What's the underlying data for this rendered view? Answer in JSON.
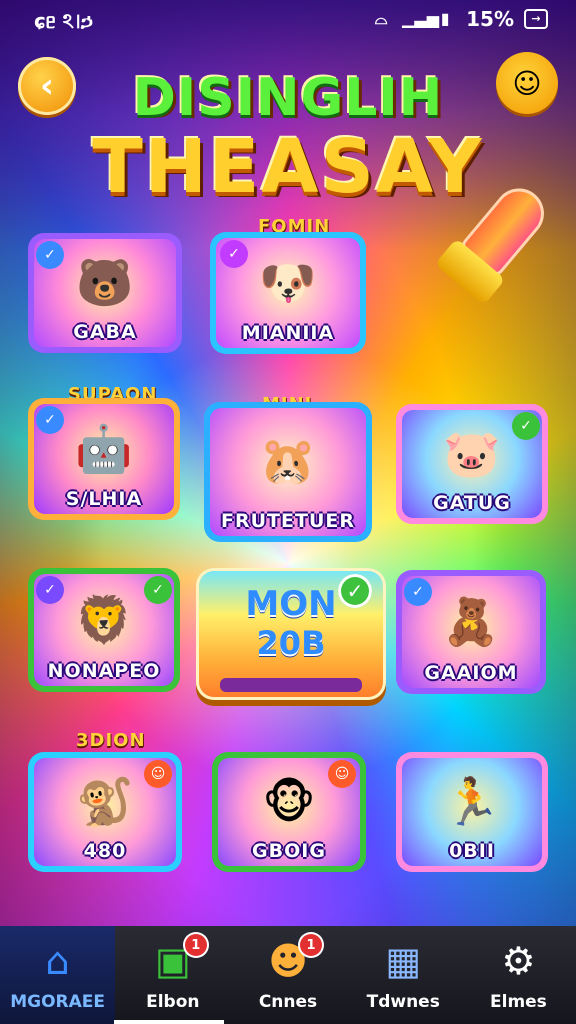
{
  "status": {
    "time": "ɕᥱ ঽ।ኃ",
    "battery": "15%"
  },
  "header": {
    "title_line1": "DISINGLIH",
    "title_line2": "THEASAY"
  },
  "colors": {
    "accent": "#ffcf2e",
    "nav_bg": "#1c1c24",
    "active": "#2e6bff"
  },
  "tiles": [
    {
      "label": "GABA",
      "above": "",
      "icon": "bear-icon"
    },
    {
      "label": "MIANIIA",
      "above": "FOMIN",
      "icon": "puppy-icon"
    },
    {
      "label": "S/LHIA",
      "above": "SUPAON",
      "icon": "robot-icon"
    },
    {
      "label": "FRUTETUER",
      "above": "MINI",
      "icon": "hamster-icon"
    },
    {
      "label": "GATUG",
      "above": "",
      "icon": "pig-icon"
    },
    {
      "label": "NONAPEO",
      "above": "",
      "icon": "lion-icon"
    },
    {
      "label": "GAAIOM",
      "above": "",
      "icon": "teddy-icon"
    },
    {
      "label": "480",
      "above": "3DION",
      "icon": "monkey-icon"
    },
    {
      "label": "GBOIG",
      "above": "",
      "icon": "monkey-pair-icon"
    },
    {
      "label": "0BII",
      "above": "",
      "icon": "runner-icon"
    }
  ],
  "center": {
    "line1": "MON",
    "line2": "20B"
  },
  "nav": [
    {
      "label": "MGORAEE",
      "icon": "home-icon",
      "active": true
    },
    {
      "label": "Elbon",
      "icon": "blocks-icon",
      "badge": "1"
    },
    {
      "label": "Cnnes",
      "icon": "bear-face-icon",
      "badge": "1"
    },
    {
      "label": "Tdwnes",
      "icon": "cube-icon"
    },
    {
      "label": "Elmes",
      "icon": "gear-icon"
    }
  ]
}
